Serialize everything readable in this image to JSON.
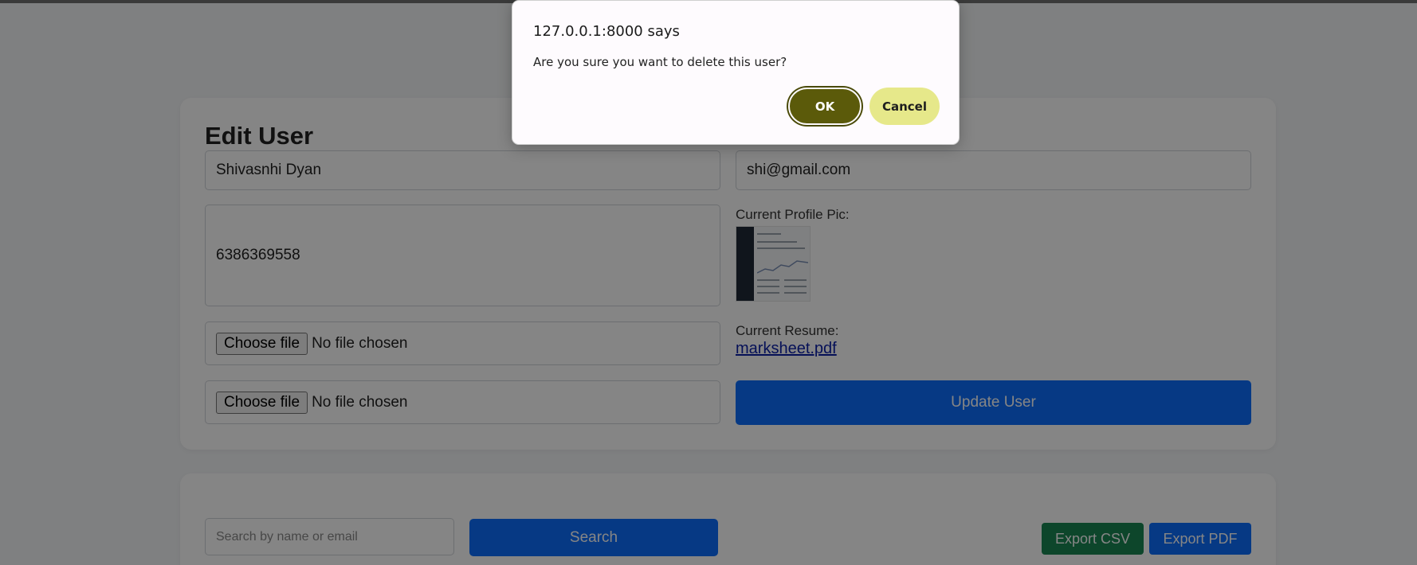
{
  "edit_form": {
    "title": "Edit User",
    "name_value": "Shivasnhi Dyan",
    "email_value": "shi@gmail.com",
    "phone_value": "6386369558",
    "file_button_label": "Choose file",
    "no_file_text": "No file chosen",
    "profile_pic_label": "Current Profile Pic:",
    "resume_label": "Current Resume:",
    "resume_link": "marksheet.pdf",
    "update_button": "Update User"
  },
  "list_section": {
    "search_placeholder": "Search by name or email",
    "search_button": "Search",
    "export_csv": "Export CSV",
    "export_pdf": "Export PDF"
  },
  "dialog": {
    "origin": "127.0.0.1:8000 says",
    "message": "Are you sure you want to delete this user?",
    "ok_label": "OK",
    "cancel_label": "Cancel"
  },
  "colors": {
    "primary": "#0d6efd",
    "success": "#198754",
    "ok_button": "#5b5a0a",
    "cancel_button": "#e6e88a"
  }
}
